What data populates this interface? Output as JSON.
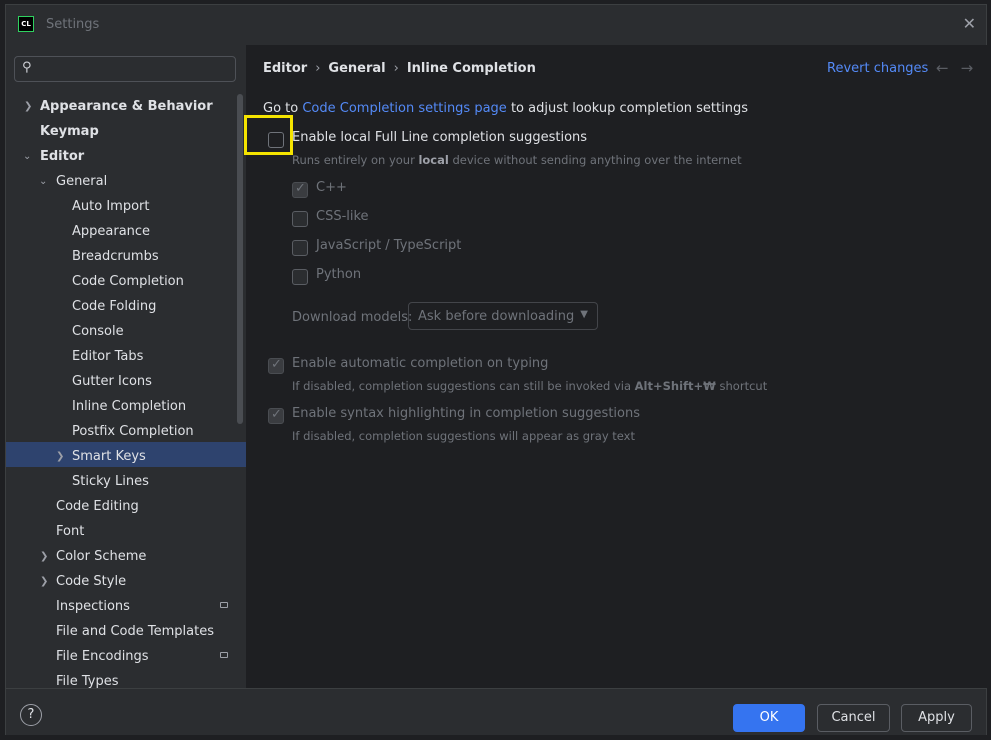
{
  "window": {
    "title": "Settings",
    "logo_text": "CL"
  },
  "search": {
    "placeholder": ""
  },
  "tree": [
    {
      "label": "Appearance & Behavior"
    },
    {
      "label": "Keymap"
    },
    {
      "label": "Editor"
    },
    {
      "label": "General"
    },
    {
      "label": "Auto Import"
    },
    {
      "label": "Appearance"
    },
    {
      "label": "Breadcrumbs"
    },
    {
      "label": "Code Completion"
    },
    {
      "label": "Code Folding"
    },
    {
      "label": "Console"
    },
    {
      "label": "Editor Tabs"
    },
    {
      "label": "Gutter Icons"
    },
    {
      "label": "Inline Completion"
    },
    {
      "label": "Postfix Completion"
    },
    {
      "label": "Smart Keys"
    },
    {
      "label": "Sticky Lines"
    },
    {
      "label": "Code Editing"
    },
    {
      "label": "Font"
    },
    {
      "label": "Color Scheme"
    },
    {
      "label": "Code Style"
    },
    {
      "label": "Inspections"
    },
    {
      "label": "File and Code Templates"
    },
    {
      "label": "File Encodings"
    },
    {
      "label": "File Types"
    }
  ],
  "breadcrumb": [
    "Editor",
    "General",
    "Inline Completion"
  ],
  "revert_label": "Revert changes",
  "nav_arrows": "←→",
  "content": {
    "goto_prefix": "Go to",
    "goto_link": "Code Completion settings page",
    "goto_suffix": "to adjust lookup completion settings",
    "full_line_label": "Enable local Full Line completion suggestions",
    "full_line_hint_a": "Runs entirely on your",
    "full_line_hint_b": "local",
    "full_line_hint_c": "device without sending anything over the internet",
    "languages": [
      "C++",
      "CSS-like",
      "JavaScript / TypeScript",
      "Python"
    ],
    "download_label": "Download models:",
    "download_value": "Ask before downloading",
    "auto_label": "Enable automatic completion on typing",
    "auto_hint_a": "If disabled, completion suggestions can still be invoked via",
    "auto_hint_b": "Alt+Shift+₩",
    "auto_hint_c": "shortcut",
    "syntax_label": "Enable syntax highlighting in completion suggestions",
    "syntax_hint": "If disabled, completion suggestions will appear as gray text"
  },
  "footer": {
    "help": "?",
    "ok": "OK",
    "cancel": "Cancel",
    "apply": "Apply"
  }
}
